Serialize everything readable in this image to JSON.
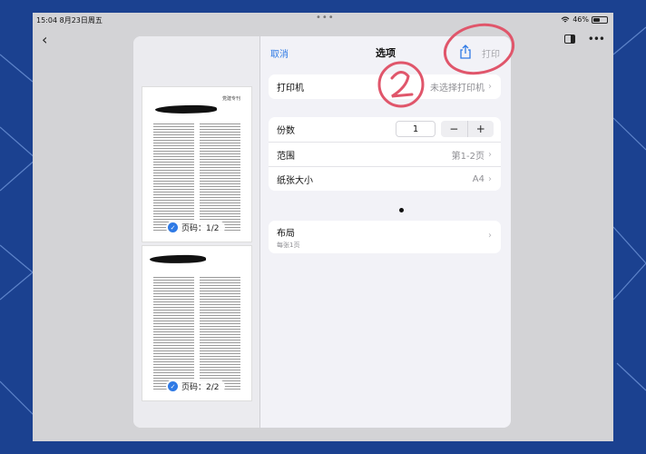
{
  "status_bar": {
    "time": "15:04",
    "date": "8月23日周五",
    "battery": "46%"
  },
  "nav": {
    "cancel": "取消",
    "title": "选项",
    "print": "打印"
  },
  "printer": {
    "label": "打印机",
    "value": "未选择打印机"
  },
  "copies": {
    "label": "份数",
    "value": "1",
    "minus": "−",
    "plus": "+"
  },
  "range": {
    "label": "范围",
    "value": "第1-2页"
  },
  "paper": {
    "label": "纸张大小",
    "value": "A4"
  },
  "layout": {
    "label": "布局",
    "sublabel": "每张1页"
  },
  "preview": {
    "pages": [
      {
        "label": "页码：1/2",
        "header_text": "党建专刊"
      },
      {
        "label": "页码：2/2",
        "header_text": ""
      }
    ]
  },
  "annotation": {
    "number": "2",
    "color": "#e0566b"
  },
  "colors": {
    "accent": "#2f7ae5",
    "background": "#1a3f8a"
  }
}
